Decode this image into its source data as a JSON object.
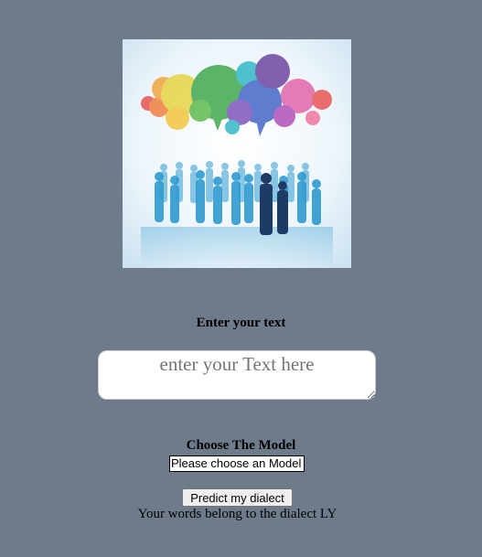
{
  "text_section": {
    "label": "Enter your text",
    "placeholder": "enter your Text here",
    "value": ""
  },
  "model_section": {
    "label": "Choose The Model",
    "selected": "Please choose an Model"
  },
  "actions": {
    "predict_label": "Predict my dialect"
  },
  "result": {
    "text": "Your words belong to the dialect LY"
  },
  "colors": {
    "background": "#6e7b8b",
    "bubble_red": "#e8504f",
    "bubble_orange": "#f0a23a",
    "bubble_yellow": "#e6d33e",
    "bubble_green": "#3aa648",
    "bubble_teal": "#2bb5c6",
    "bubble_blue": "#3f61c4",
    "bubble_purple": "#6a3fa0",
    "bubble_pink": "#e060a8",
    "people": "#2f9bd0"
  },
  "icons": {
    "hero_image": "speech-bubbles-crowd-illustration"
  }
}
